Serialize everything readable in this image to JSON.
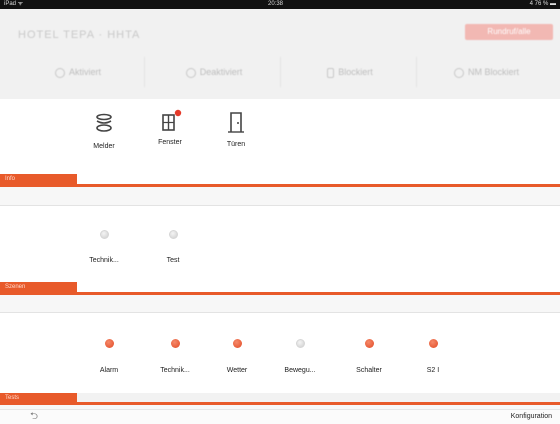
{
  "status": {
    "left": "iPad ᯤ",
    "time": "20:38",
    "right": "4 76 % ▬"
  },
  "header": {
    "brand": "HOTEL TEPA · HHTA",
    "action_button": "Rundruf/alle",
    "tabs": [
      {
        "label": "Aktiviert",
        "icon": "circle-icon"
      },
      {
        "label": "Deaktiviert",
        "icon": "circle-icon"
      },
      {
        "label": "Blockiert",
        "icon": "lock-icon"
      },
      {
        "label": "NM Blockiert",
        "icon": "circle-icon"
      }
    ]
  },
  "sections": {
    "info": {
      "tag": "Info",
      "items": [
        {
          "label": "Melder",
          "icon": "detector-icon"
        },
        {
          "label": "Fenster",
          "icon": "window-icon",
          "badge": true
        },
        {
          "label": "Türen",
          "icon": "door-icon"
        }
      ]
    },
    "szenen": {
      "tag": "Szenen",
      "items": [
        {
          "label": "Technik...",
          "state": "off"
        },
        {
          "label": "Test",
          "state": "off"
        }
      ]
    },
    "tests": {
      "tag": "Tests",
      "items": [
        {
          "label": "Alarm",
          "state": "on"
        },
        {
          "label": "Technik...",
          "state": "on"
        },
        {
          "label": "Wetter",
          "state": "on"
        },
        {
          "label": "Bewegu...",
          "state": "off"
        },
        {
          "label": "Schalter",
          "state": "on"
        },
        {
          "label": "S2 I",
          "state": "on"
        }
      ]
    }
  },
  "footer": {
    "back_symbol": "⮌",
    "config_label": "Konfiguration"
  },
  "colors": {
    "accent": "#e85a2a",
    "pill": "#f2b8b3"
  }
}
